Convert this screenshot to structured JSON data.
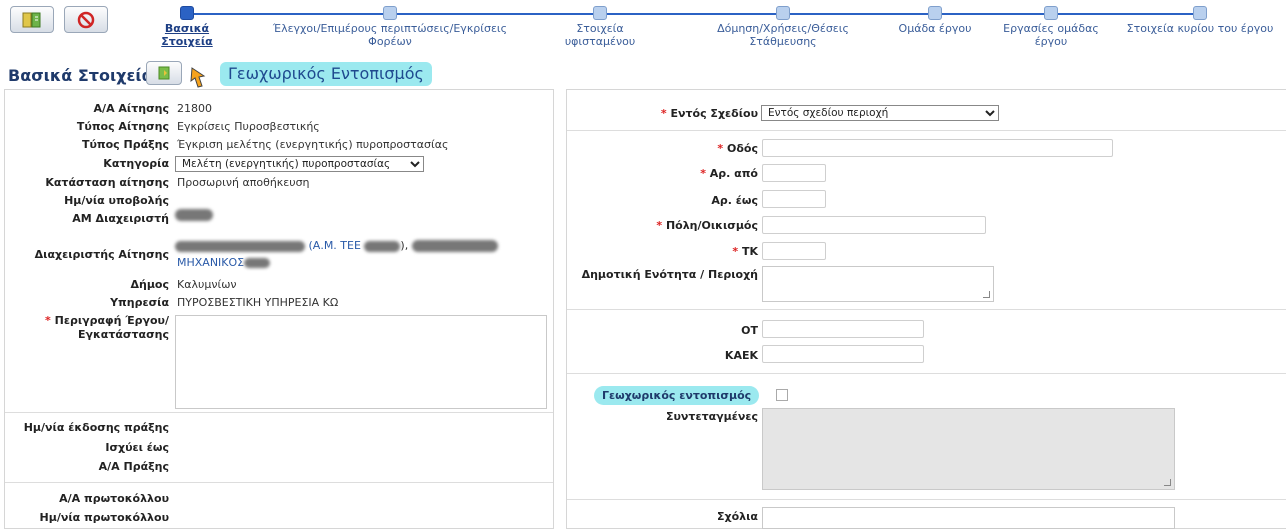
{
  "wizard": {
    "steps": [
      {
        "label": "Βασικά Στοιχεία",
        "active": true
      },
      {
        "label": "Έλεγχοι/Επιμέρους περιπτώσεις/Εγκρίσεις Φορέων",
        "active": false
      },
      {
        "label": "Στοιχεία υφισταμένου",
        "active": false
      },
      {
        "label": "Δόμηση/Χρήσεις/Θέσεις Στάθμευσης",
        "active": false
      },
      {
        "label": "Ομάδα έργου",
        "active": false
      },
      {
        "label": "Εργασίες ομάδας έργου",
        "active": false
      },
      {
        "label": "Στοιχεία κυρίου του έργου",
        "active": false
      }
    ]
  },
  "header": {
    "title": "Βασικά Στοιχεία",
    "geo_highlight": "Γεωχωρικός Εντοπισμός"
  },
  "left": {
    "aa_label": "Α/Α Αίτησης",
    "aa_value": "21800",
    "type_label": "Τύπος Αίτησης",
    "type_value": "Εγκρίσεις Πυροσβεστικής",
    "act_label": "Τύπος Πράξης",
    "act_value": "Έγκριση μελέτης (ενεργητικής) πυροπροστασίας",
    "cat_label": "Κατηγορία",
    "cat_value": "Μελέτη (ενεργητικής) πυροπροστασίας",
    "status_label": "Κατάσταση αίτησης",
    "status_value": "Προσωρινή αποθήκευση",
    "subdate_label": "Ημ/νία υποβολής",
    "am_label": "ΑΜ Διαχειριστή",
    "mgr_label": "Διαχειριστής Αίτησης",
    "mgr_value_line1": "(Α.Μ. ΤΕΕ",
    "mgr_value_line2": "ΜΗΧΑΝΙΚΟΣ",
    "dimos_label": "Δήμος",
    "dimos_value": "Καλυμνίων",
    "service_label": "Υπηρεσία",
    "service_value": "ΠΥΡΟΣΒΕΣΤΙΚΗ ΥΠΗΡΕΣΙΑ ΚΩ",
    "desc_label_1": "Περιγραφή Έργου/",
    "desc_label_2": "Εγκατάστασης",
    "issue_label": "Ημ/νία έκδοσης πράξης",
    "valid_label": "Ισχύει έως",
    "aapraxis_label": "Α/Α Πράξης",
    "proto_label": "Α/Α πρωτοκόλλου",
    "protodate_label": "Ημ/νία πρωτοκόλλου"
  },
  "right": {
    "plan_label": "Εντός Σχεδίου",
    "plan_value": "Εντός σχεδίου περιοχή",
    "street_label": "Οδός",
    "from_label": "Αρ. από",
    "to_label": "Αρ. έως",
    "city_label": "Πόλη/Οικισμός",
    "tk_label": "ΤΚ",
    "unit_label": "Δημοτική Ενότητα / Περιοχή",
    "ot_label": "ΟΤ",
    "kaek_label": "ΚΑΕΚ",
    "geo_label": "Γεωχωρικός εντοπισμός",
    "coords_label": "Συντεταγμένες",
    "comments_label": "Σχόλια"
  }
}
